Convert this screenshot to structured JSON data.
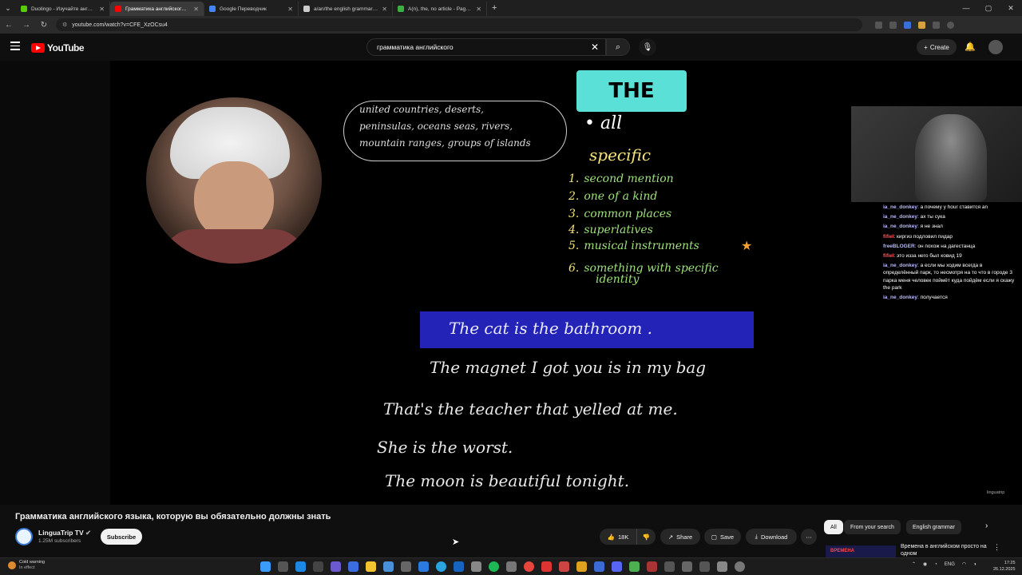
{
  "browser": {
    "tabs": [
      {
        "label": "Duolingo - Изучайте английск...",
        "color": "#58cc02",
        "active": false
      },
      {
        "label": "Грамматика английского я...",
        "color": "#ff0000",
        "active": true
      },
      {
        "label": "Google Переводчик",
        "color": "#4285f4",
        "active": false
      },
      {
        "label": "a/an/the english grammar gam...",
        "color": "#cccccc",
        "active": false
      },
      {
        "label": "A(n), the, no article - Page 3 of...",
        "color": "#3cb043",
        "active": false
      }
    ],
    "url": "youtube.com/watch?v=CFE_XzOCsu4"
  },
  "header": {
    "logo": "YouTube",
    "search_value": "грамматика английского",
    "create_label": "Create"
  },
  "video": {
    "bubble_lines": [
      "united countries, deserts,",
      "peninsulas, oceans seas, rivers,",
      "mountain ranges, groups of islands"
    ],
    "the_label": "THE",
    "all_label": "• all",
    "specific_label": "specific",
    "rules": [
      {
        "num": "1.",
        "text": "second mention"
      },
      {
        "num": "2.",
        "text": "one of a kind"
      },
      {
        "num": "3.",
        "text": "common places"
      },
      {
        "num": "4.",
        "text": "superlatives"
      },
      {
        "num": "5.",
        "text": "musical instruments"
      },
      {
        "num": "6.",
        "text": "something with specific"
      }
    ],
    "rule6_cont": "identity",
    "banner_sentence": "The cat is the bathroom .",
    "sentences": [
      "The magnet I got you is in my bag",
      "That's the teacher that yelled at me.",
      "She is the worst.",
      "The moon is beautiful tonight."
    ],
    "watermark": "linguatrip"
  },
  "chat": [
    {
      "user": "ia_ne_donkey",
      "text": "а почему у hour ставится an",
      "red": false
    },
    {
      "user": "ia_ne_donkey",
      "text": "ах ты сука",
      "red": false
    },
    {
      "user": "ia_ne_donkey",
      "text": "я не знал",
      "red": false
    },
    {
      "user": "fifiel",
      "text": "киргиз подловил пидар",
      "red": true
    },
    {
      "user": "freeBLOGER",
      "text": "он похож на дагестанца",
      "red": false
    },
    {
      "user": "fifiel",
      "text": "это изза него был ковид 19",
      "red": true
    },
    {
      "user": "ia_ne_donkey",
      "text": "а если мы ходим всегда в определённый парк, то несмотря на то что в городе 3 парка меня человек поймёт куда пойдём если я скажу the park",
      "red": false
    },
    {
      "user": "ia_ne_donkey",
      "text": "получается",
      "red": false
    }
  ],
  "details": {
    "title": "Грамматика английского языка, которую вы обязательно должны знать",
    "channel": "LinguaTrip TV",
    "subscribers": "1.25M subscribers",
    "subscribe_label": "Subscribe",
    "likes": "18K",
    "share_label": "Share",
    "save_label": "Save",
    "download_label": "Download"
  },
  "chips": [
    "All",
    "From your search",
    "English grammar"
  ],
  "recommendation": {
    "thumb_text": "ВРЕМЕНА",
    "title": "Времена в английском просто на одном"
  },
  "taskbar": {
    "weather_title": "Cold warning",
    "weather_sub": "In effect",
    "lang": "ENG",
    "time": "17:25",
    "date": "26.12.2025"
  }
}
